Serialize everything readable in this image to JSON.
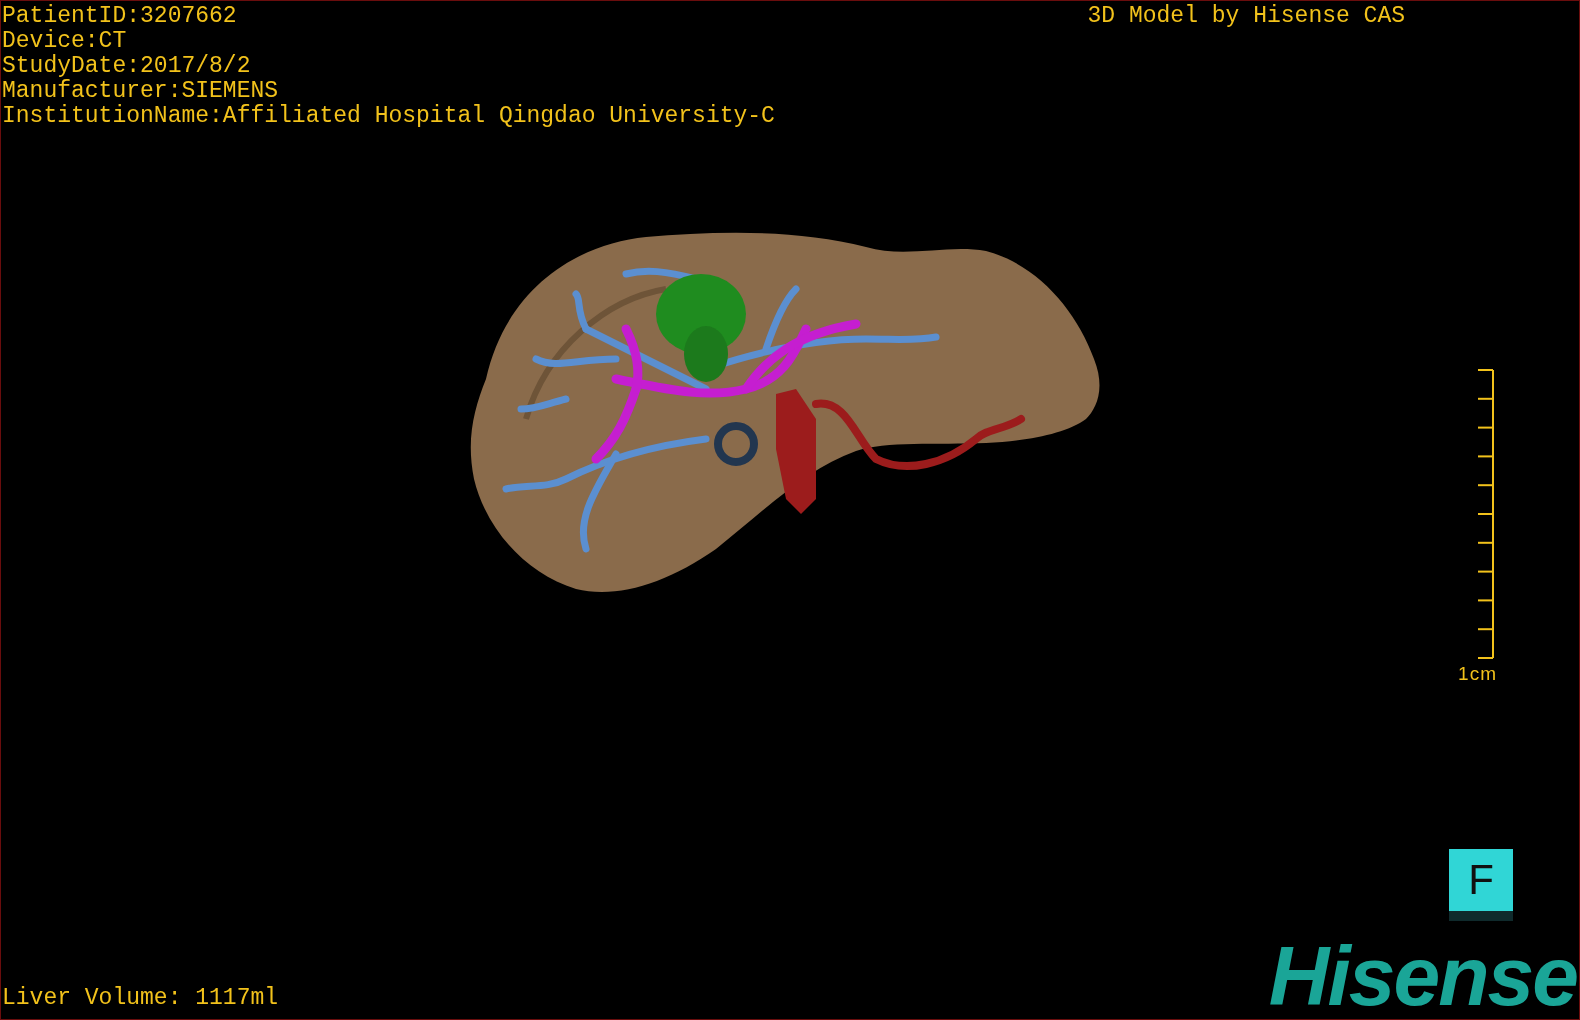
{
  "header": {
    "info_lines": [
      "PatientID:3207662",
      "Device:CT",
      "StudyDate:2017/8/2",
      "Manufacturer:SIEMENS",
      "InstitutionName:Affiliated Hospital Qingdao University-C"
    ],
    "title": "3D Model by Hisense CAS"
  },
  "scale_bar": {
    "label": "1cm"
  },
  "footer": {
    "volume": "Liver Volume: 1117ml",
    "orientation_cube": {
      "label": "F"
    },
    "logo": "Hisense"
  }
}
